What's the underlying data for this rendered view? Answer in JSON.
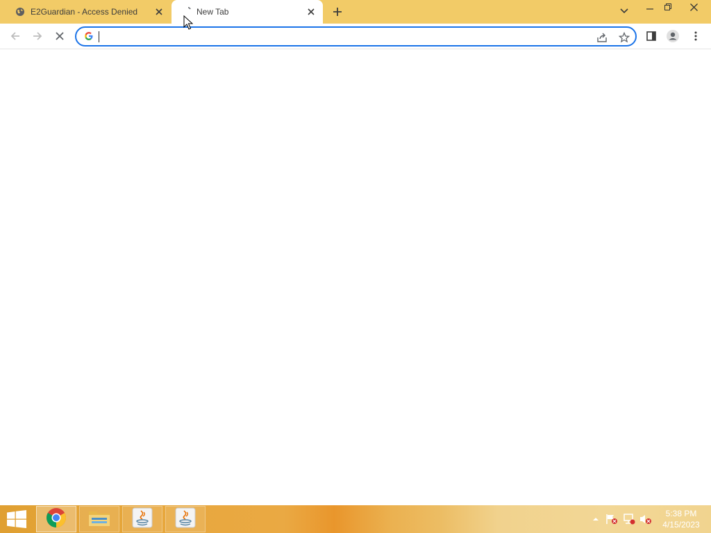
{
  "browser": {
    "tabs": [
      {
        "title": "E2Guardian - Access Denied",
        "favicon": "globe-icon",
        "active": false
      },
      {
        "title": "New Tab",
        "favicon": "loading-spinner-icon",
        "active": true
      }
    ],
    "tab_strip_color": "#f2cb67",
    "omnibox": {
      "value": "",
      "placeholder": "",
      "icon": "google-g-icon",
      "focus_color": "#1a73e8"
    }
  },
  "taskbar": {
    "apps": [
      {
        "name": "Google Chrome",
        "icon": "chrome-icon",
        "active": true
      },
      {
        "name": "File Explorer",
        "icon": "folder-icon",
        "active": false
      },
      {
        "name": "Java",
        "icon": "java-icon",
        "active": false
      },
      {
        "name": "Java",
        "icon": "java-icon",
        "active": false
      }
    ],
    "tray_icons": [
      "show-hidden-icons-icon",
      "action-center-flag-icon",
      "network-icon",
      "volume-muted-icon"
    ],
    "clock": {
      "time": "5:38 PM",
      "date": "4/15/2023"
    }
  }
}
